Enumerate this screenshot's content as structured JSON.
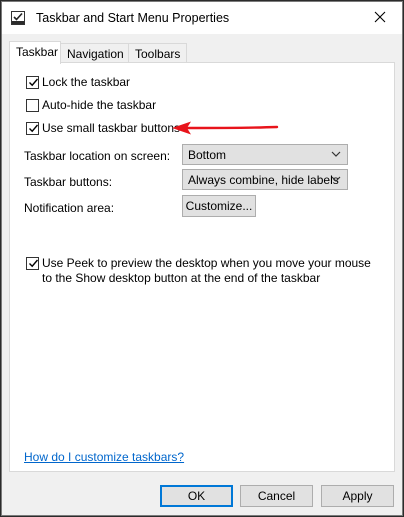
{
  "window": {
    "title": "Taskbar and Start Menu Properties",
    "app_icon": "taskbar-properties-icon",
    "close_icon": "close-icon"
  },
  "tabs": [
    {
      "label": "Taskbar",
      "active": true
    },
    {
      "label": "Navigation",
      "active": false
    },
    {
      "label": "Toolbars",
      "active": false
    }
  ],
  "options": {
    "lock_taskbar": {
      "label": "Lock the taskbar",
      "checked": true
    },
    "auto_hide": {
      "label": "Auto-hide the taskbar",
      "checked": false
    },
    "small_buttons": {
      "label": "Use small taskbar buttons",
      "checked": true
    },
    "peek": {
      "label": "Use Peek to preview the desktop when you move your mouse to the Show desktop button at the end of the taskbar",
      "checked": true
    }
  },
  "settings": {
    "location_label": "Taskbar location on screen:",
    "location_value": "Bottom",
    "buttons_label": "Taskbar buttons:",
    "buttons_value": "Always combine, hide labels",
    "notification_label": "Notification area:",
    "customize_label": "Customize..."
  },
  "help_link": "How do I customize taskbars?",
  "footer": {
    "ok": "OK",
    "cancel": "Cancel",
    "apply": "Apply"
  },
  "annotation": {
    "arrow_color": "#e8141b"
  }
}
